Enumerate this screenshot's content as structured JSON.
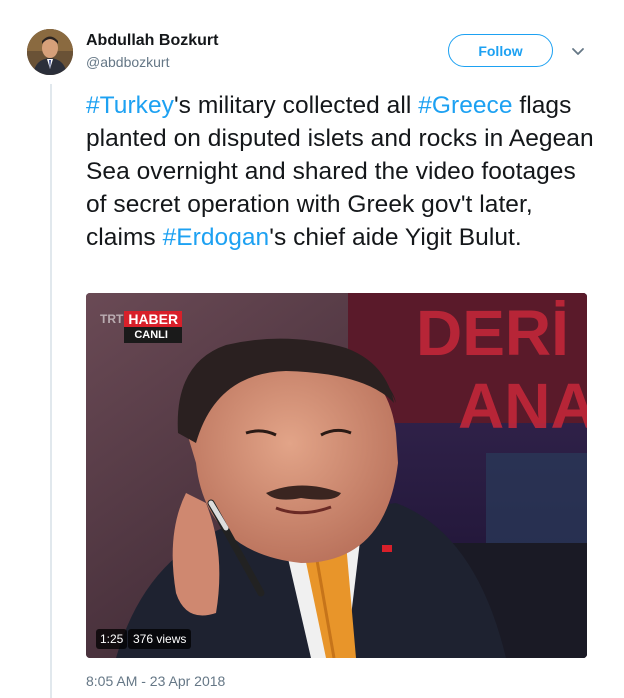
{
  "tweet": {
    "display_name": "Abdullah Bozkurt",
    "handle": "@abdbozkurt",
    "follow_label": "Follow",
    "text_parts": [
      {
        "type": "hashtag",
        "text": "#Turkey"
      },
      {
        "type": "text",
        "text": "'s military collected all "
      },
      {
        "type": "hashtag",
        "text": "#Greece"
      },
      {
        "type": "text",
        "text": " flags planted on disputed islets and rocks in Aegean Sea overnight and shared the video footages of secret operation with Greek gov't later, claims "
      },
      {
        "type": "hashtag",
        "text": "#Erdogan"
      },
      {
        "type": "text",
        "text": "'s chief aide Yigit Bulut."
      }
    ],
    "timestamp": "8:05 AM - 23 Apr 2018"
  },
  "video": {
    "logo_prefix": "TRT",
    "logo_main": "HABER",
    "logo_sub": "CANLI",
    "background_text_line1": "DERİ",
    "background_text_line2": "ANA",
    "duration": "1:25",
    "views": "376 views"
  },
  "icons": {
    "caret": "chevron-down-icon",
    "avatar": "avatar"
  },
  "colors": {
    "link": "#1da1f2",
    "secondary_text": "#657786",
    "primary_text": "#14171a",
    "logo_red": "#d8202a"
  }
}
